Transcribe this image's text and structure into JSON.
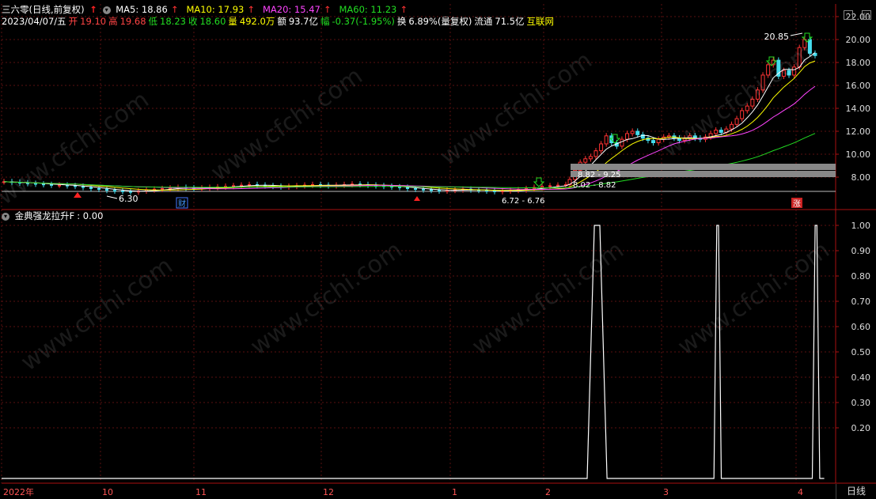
{
  "header": {
    "stock_name": "三六零(日线,前复权)",
    "ma": [
      {
        "label": "MA5: 18.86",
        "color": "#ffffff"
      },
      {
        "label": "MA10: 17.93",
        "color": "#ffff00"
      },
      {
        "label": "MA20: 15.47",
        "color": "#ff44ff"
      },
      {
        "label": "MA60: 11.23",
        "color": "#22dd22"
      }
    ],
    "date": "2023/04/07/五",
    "open_label": "开",
    "open": "19.10",
    "high_label": "高",
    "high": "19.68",
    "low_label": "低",
    "low": "18.23",
    "close_label": "收",
    "close": "18.60",
    "vol_label": "量",
    "vol": "492.0万",
    "amount_label": "额",
    "amount": "93.7亿",
    "change_label": "幅",
    "change": "-0.37(-1.95%)",
    "turnover_label": "换",
    "turnover": "6.89%(量复权)",
    "float_label": "流通",
    "float": "71.5亿",
    "sector": "互联网"
  },
  "indicator": {
    "label": "金典强龙拉升F",
    "value": ": 0.00"
  },
  "period_tab": "日线",
  "watermark": "www.cfchi.com",
  "chart_data": [
    {
      "type": "candlestick",
      "title": "三六零(日线,前复权)",
      "y_ticks": [
        "8.00",
        "10.00",
        "12.00",
        "14.00",
        "16.00",
        "18.00",
        "20.00",
        "22.00"
      ],
      "ylim": [
        6.5,
        22.5
      ],
      "x_month_labels": [
        "2022年",
        "10",
        "11",
        "12",
        "1",
        "2",
        "3",
        "4"
      ],
      "annotations": {
        "high_mark": "20.85",
        "low_mark": "6.30",
        "range_a": "6.72 - 6.76",
        "range_b": "8.02 - 8.82",
        "range_c": "8.82 - 9.25",
        "badge_cai": "财",
        "badge_zhang": "涨"
      },
      "series": [
        {
          "name": "MA5",
          "color": "#ffffff"
        },
        {
          "name": "MA10",
          "color": "#ffff00"
        },
        {
          "name": "MA20",
          "color": "#ff44ff"
        },
        {
          "name": "MA60",
          "color": "#22dd22"
        }
      ],
      "phase1_close": [
        7.6,
        7.55,
        7.5,
        7.45,
        7.4,
        7.35,
        7.3,
        7.3,
        7.25,
        7.2,
        7.1,
        7.0,
        6.95,
        6.85,
        6.8,
        6.75,
        6.7,
        6.8,
        6.9,
        6.95,
        7.0,
        7.05,
        7.1,
        7.05,
        7.0,
        7.05,
        7.1,
        7.15,
        7.2,
        7.25,
        7.3,
        7.35,
        7.3,
        7.25,
        7.2,
        7.15,
        7.2,
        7.25,
        7.3,
        7.35,
        7.3,
        7.25,
        7.3,
        7.35,
        7.4,
        7.35,
        7.3,
        7.25,
        7.2,
        7.15,
        7.1,
        7.0,
        6.95,
        6.9,
        6.85,
        6.8,
        6.85,
        6.9,
        6.95,
        6.9,
        6.85,
        6.8,
        6.75,
        6.8,
        6.85,
        6.9,
        7.0,
        7.1,
        7.2,
        7.25,
        7.3,
        7.35
      ],
      "phase2_close": [
        7.8,
        8.6,
        9.3,
        9.6,
        9.8,
        10.3,
        10.9,
        11.6,
        11.0,
        10.7,
        11.3,
        11.8,
        12.0,
        11.7,
        11.4,
        11.2,
        11.0,
        11.3,
        11.5,
        11.6,
        11.4,
        11.2,
        11.4,
        11.6,
        11.4,
        11.3,
        11.5,
        11.8,
        12.1,
        11.9,
        12.2,
        12.6,
        13.1,
        13.8,
        14.2,
        14.8,
        15.6,
        16.9,
        17.8,
        18.2,
        16.8,
        17.3,
        16.9,
        17.6,
        19.3,
        20.0,
        18.8,
        18.6
      ]
    },
    {
      "type": "line",
      "title": "金典强龙拉升F",
      "y_ticks": [
        "0.20",
        "0.30",
        "0.40",
        "0.50",
        "0.60",
        "0.70",
        "0.80",
        "0.90",
        "1.00"
      ],
      "ylim": [
        0,
        1.0
      ],
      "pulses": [
        {
          "start": 0.703,
          "end": 0.725,
          "value": 1.0
        },
        {
          "start": 0.855,
          "end": 0.862,
          "value": 1.0
        },
        {
          "start": 0.973,
          "end": 0.98,
          "value": 1.0
        }
      ],
      "baseline": 0.0
    }
  ]
}
